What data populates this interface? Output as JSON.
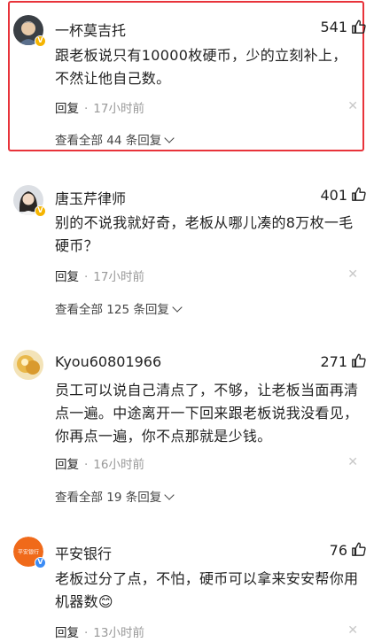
{
  "comments": [
    {
      "author": "一杯莫吉托",
      "likes": "541",
      "text": "跟老板说只有10000枚硬币，少的立刻补上，不然让他自己数。",
      "reply_label": "回复",
      "dot": "·",
      "time": "17小时前",
      "view_all": "查看全部 44 条回复",
      "highlighted": true,
      "badge": "gold"
    },
    {
      "author": "唐玉芹律师",
      "likes": "401",
      "text": "别的不说我就好奇，老板从哪儿凑的8万枚一毛硬币？",
      "reply_label": "回复",
      "dot": "·",
      "time": "17小时前",
      "view_all": "查看全部 125 条回复",
      "highlighted": false,
      "badge": "gold"
    },
    {
      "author": "Kyou60801966",
      "likes": "271",
      "text": "员工可以说自己清点了，不够，让老板当面再清点一遍。中途离开一下回来跟老板说我没看见，你再点一遍，你不点那就是少钱。",
      "reply_label": "回复",
      "dot": "·",
      "time": "16小时前",
      "view_all": "查看全部 19 条回复",
      "highlighted": false,
      "badge": "none"
    },
    {
      "author": "平安银行",
      "likes": "76",
      "text": "老板过分了点，不怕，硬币可以拿来安安帮你用机器数😊",
      "reply_label": "回复",
      "dot": "·",
      "time": "13小时前",
      "highlighted": false,
      "badge": "blue"
    }
  ],
  "icons": {
    "like": "thumbs-up-icon",
    "dismiss": "close-icon",
    "expand": "chevron-down-icon"
  },
  "colors": {
    "highlight_border": "#e8333a",
    "meta_gray": "#999999",
    "gold_badge": "#f5b400",
    "blue_badge": "#3b8bf5"
  },
  "avatar_text": {
    "bank": "平安银行"
  }
}
